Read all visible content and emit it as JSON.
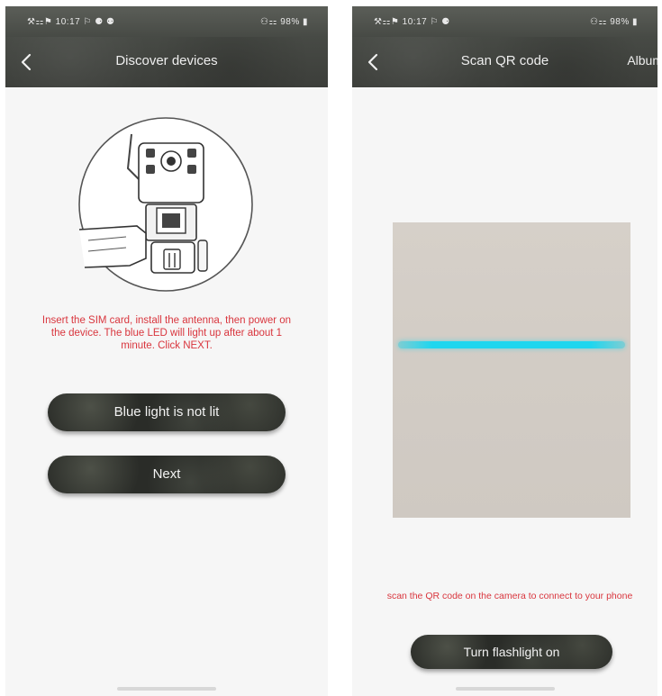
{
  "colors": {
    "header_bg": "#474a45",
    "instruction_red": "#d9363e",
    "button_bg": "#2a2c28",
    "scan_line": "#1fd6ef",
    "page_bg": "#f6f6f6"
  },
  "left_screen": {
    "status_bar": {
      "left": "⚒⚏⚑ 10:17 ⚐ ⚈ ⚉",
      "right": "⚇⚏ 98% ▮"
    },
    "nav": {
      "back_icon": "chevron-left-icon",
      "title": "Discover devices"
    },
    "illustration_icon": "camera-device-illustration",
    "instruction": "Insert the SIM card, install the antenna, then power on the device. The blue LED will light up after about 1 minute. Click NEXT.",
    "buttons": {
      "blue_light": "Blue light is not lit",
      "next": "Next"
    }
  },
  "right_screen": {
    "status_bar": {
      "left": "⚒⚏⚑ 10:17 ⚐ ⚈",
      "right": "⚇⚏ 98% ▮"
    },
    "nav": {
      "back_icon": "chevron-left-icon",
      "title": "Scan QR code",
      "action": "Album"
    },
    "instruction": "scan the QR code on the camera to connect to your phone",
    "buttons": {
      "flashlight": "Turn flashlight on"
    }
  }
}
